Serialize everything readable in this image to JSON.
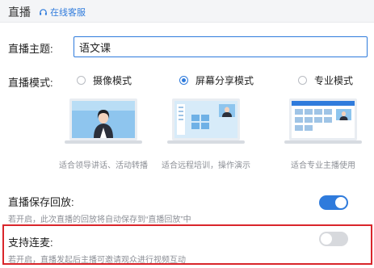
{
  "header": {
    "title": "直播",
    "service_label": "在线客服"
  },
  "topic": {
    "label": "直播主题:",
    "value": "语文课"
  },
  "mode": {
    "label": "直播模式:",
    "options": [
      {
        "label": "摄像模式",
        "caption": "适合领导讲话、活动转播",
        "checked": false
      },
      {
        "label": "屏幕分享模式",
        "caption": "适合远程培训，操作演示",
        "checked": true
      },
      {
        "label": "专业模式",
        "caption": "适合专业主播使用",
        "checked": false
      }
    ]
  },
  "save_replay": {
    "label": "直播保存回放:",
    "description": "若开启，此次直播的回放将自动保存到“直播回放”中",
    "enabled": true
  },
  "co_host": {
    "label": "支持连麦:",
    "description": "若开启，直播发起后主播可邀请观众进行视频互动",
    "enabled": false
  },
  "colors": {
    "accent": "#2f7bdc",
    "highlight_border": "#d9262b"
  }
}
